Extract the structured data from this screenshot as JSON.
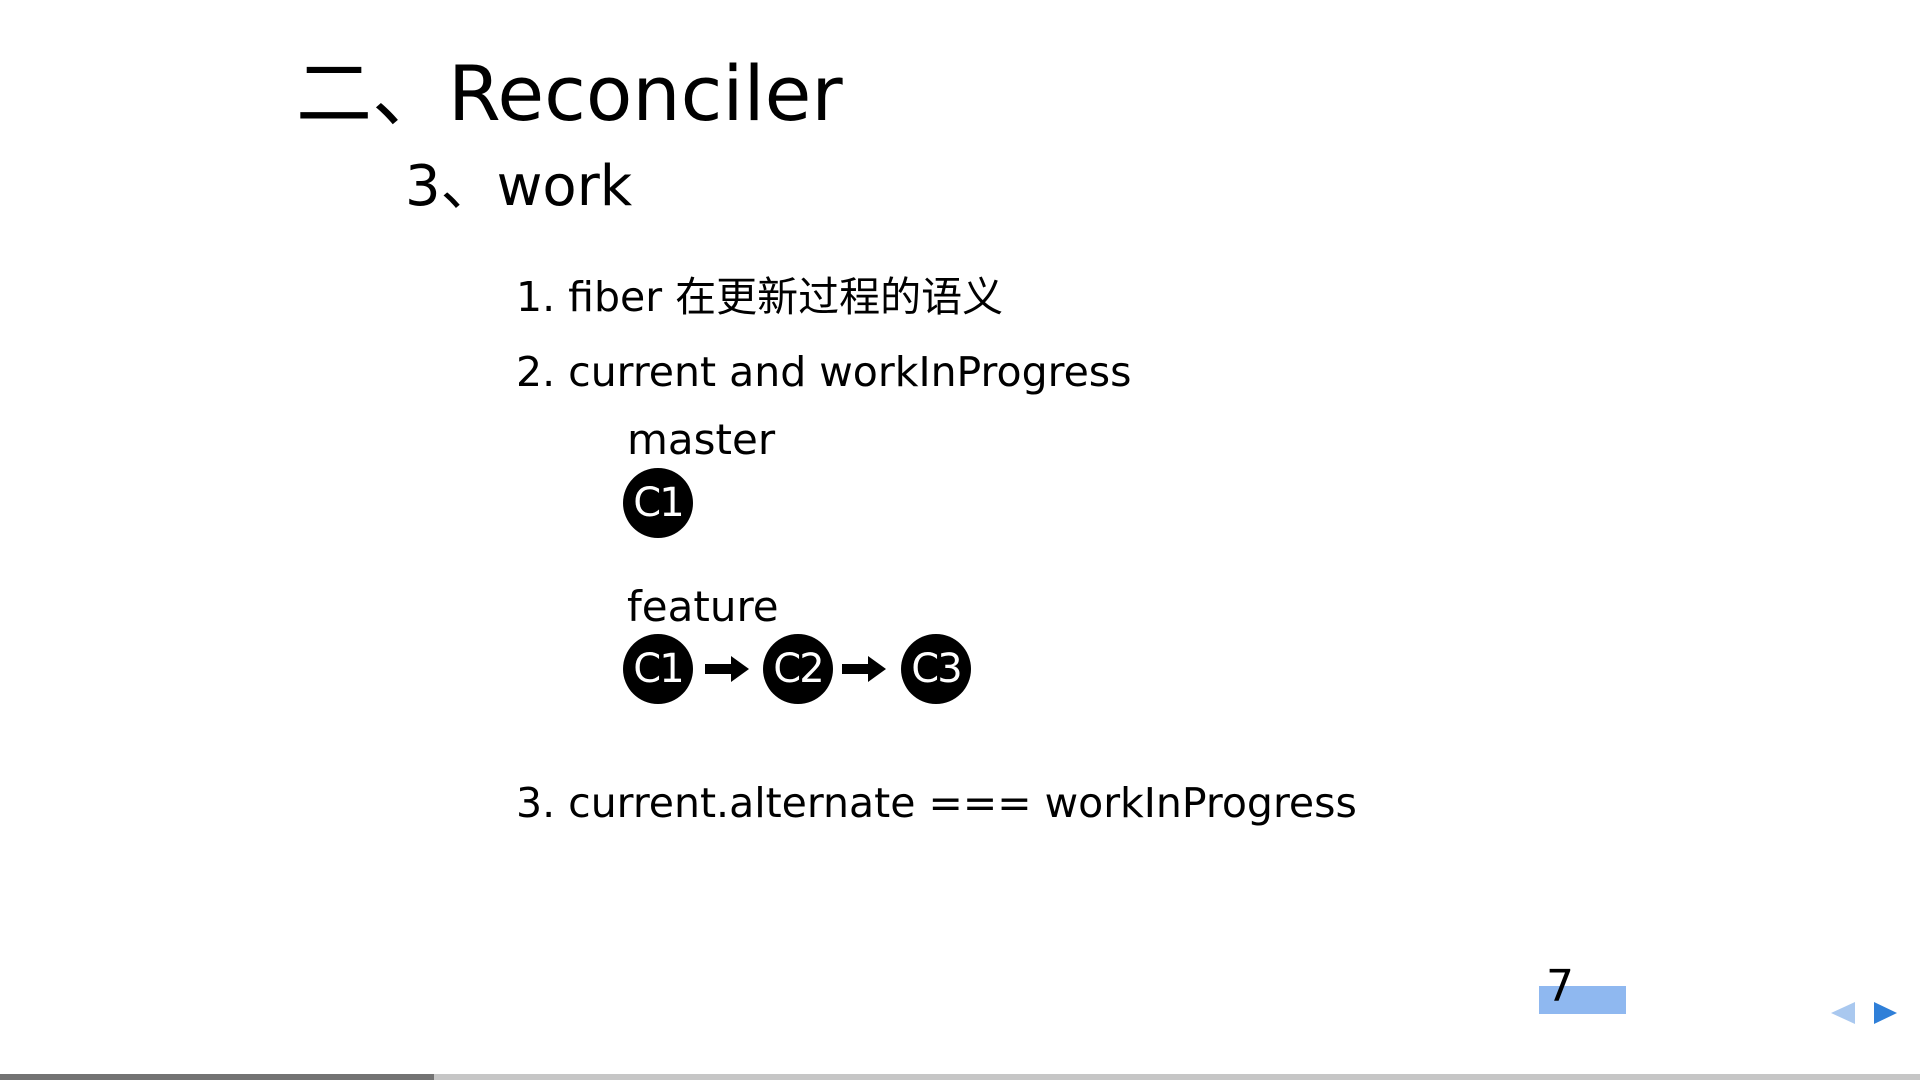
{
  "slide": {
    "title": "二、Reconciler",
    "subtitle": "3、work",
    "items": [
      "1. fiber 在更新过程的语义",
      "2. current and workInProgress",
      "3. current.alternate === workInProgress"
    ]
  },
  "diagram": {
    "master": {
      "label": "master",
      "commits": [
        "C1"
      ]
    },
    "feature": {
      "label": "feature",
      "commits": [
        "C1",
        "C2",
        "C3"
      ]
    }
  },
  "footer": {
    "page_number": "7",
    "progress": 0.226,
    "prev_icon": "triangle-left-icon",
    "next_icon": "triangle-right-icon",
    "nav_color": "#2f7fd8",
    "nav_disabled_color": "#a9c8ef",
    "highlight_color": "#8fb8f0"
  }
}
